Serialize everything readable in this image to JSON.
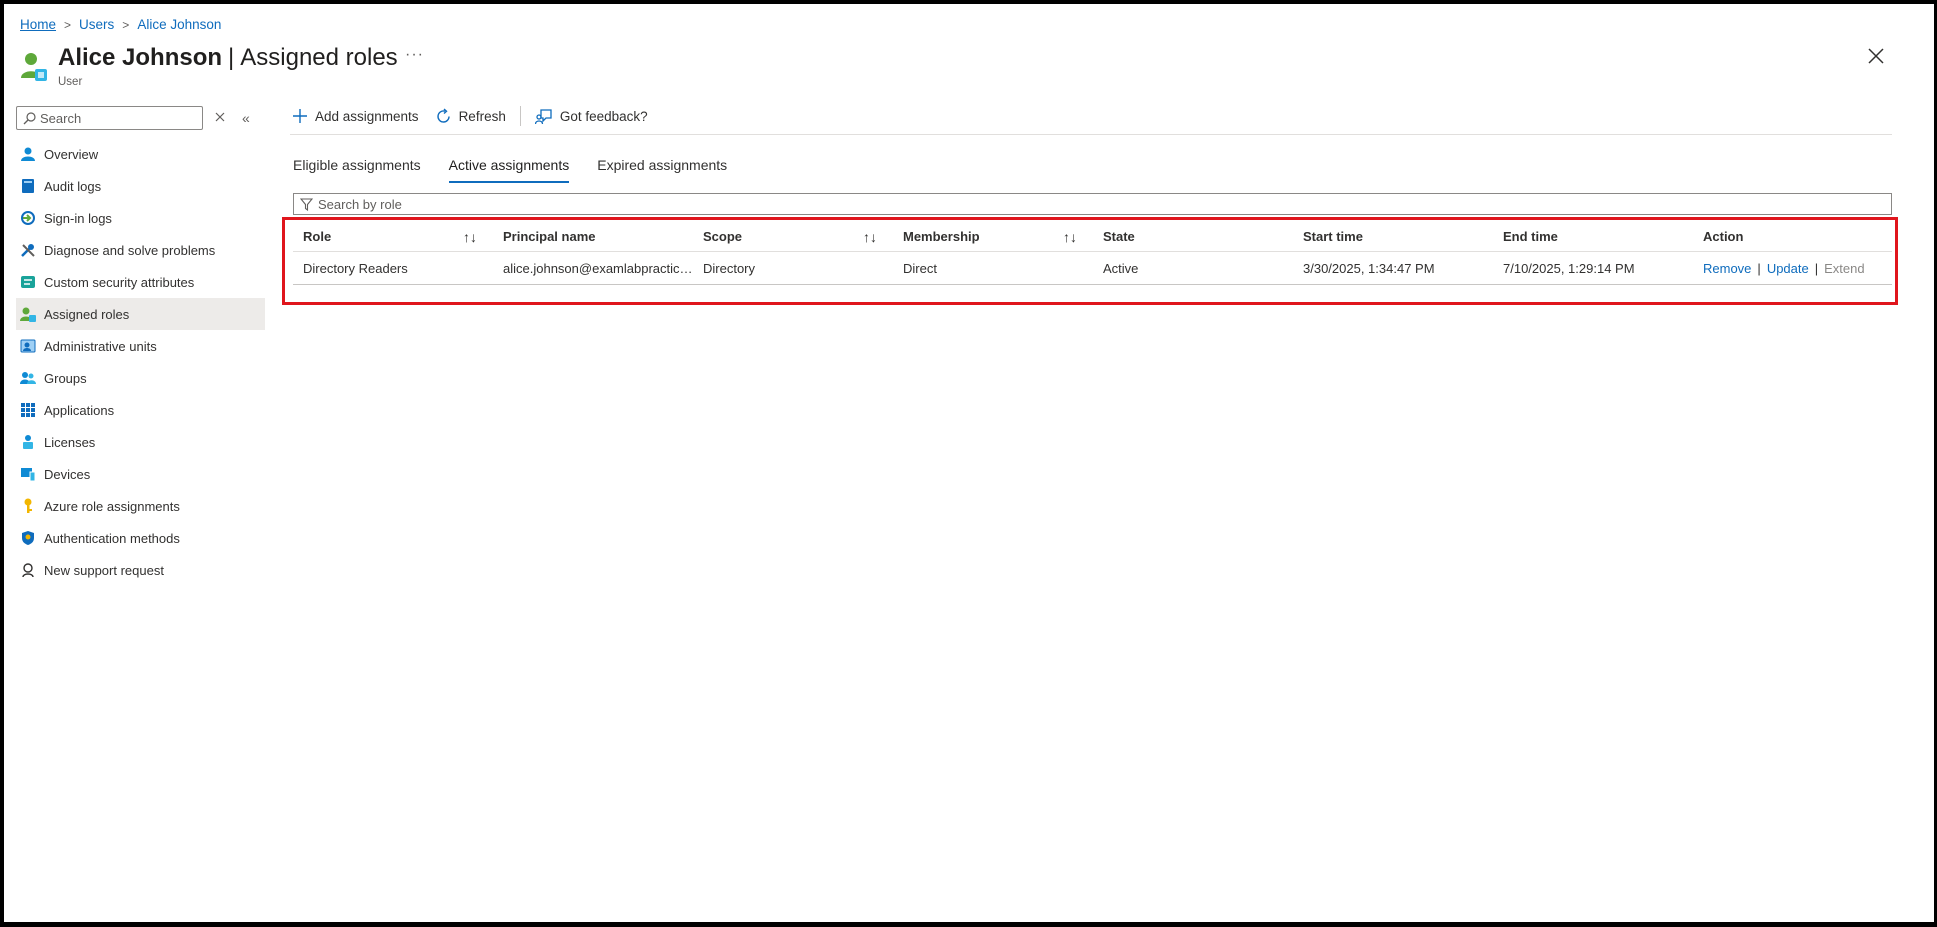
{
  "breadcrumb": {
    "home": "Home",
    "users": "Users",
    "current": "Alice Johnson"
  },
  "header": {
    "name": "Alice Johnson",
    "separator": "|",
    "section": "Assigned roles",
    "subtitle": "User",
    "more": "···"
  },
  "sidebar": {
    "search_placeholder": "Search",
    "items": [
      {
        "label": "Overview",
        "icon": "user-icon"
      },
      {
        "label": "Audit logs",
        "icon": "book-icon"
      },
      {
        "label": "Sign-in logs",
        "icon": "sign-in-icon"
      },
      {
        "label": "Diagnose and solve problems",
        "icon": "wrench-icon"
      },
      {
        "label": "Custom security attributes",
        "icon": "attributes-icon"
      },
      {
        "label": "Assigned roles",
        "icon": "assigned-roles-icon",
        "active": true
      },
      {
        "label": "Administrative units",
        "icon": "admin-units-icon"
      },
      {
        "label": "Groups",
        "icon": "groups-icon"
      },
      {
        "label": "Applications",
        "icon": "apps-grid-icon"
      },
      {
        "label": "Licenses",
        "icon": "licenses-icon"
      },
      {
        "label": "Devices",
        "icon": "devices-icon"
      },
      {
        "label": "Azure role assignments",
        "icon": "key-icon"
      },
      {
        "label": "Authentication methods",
        "icon": "shield-icon"
      },
      {
        "label": "New support request",
        "icon": "support-icon"
      }
    ]
  },
  "toolbar": {
    "add": "Add assignments",
    "refresh": "Refresh",
    "feedback": "Got feedback?"
  },
  "tabs": [
    "Eligible assignments",
    "Active assignments",
    "Expired assignments"
  ],
  "filter": {
    "placeholder": "Search by role"
  },
  "table": {
    "columns": [
      "Role",
      "Principal name",
      "Scope",
      "Membership",
      "State",
      "Start time",
      "End time",
      "Action"
    ],
    "rows": [
      {
        "role": "Directory Readers",
        "principal": "alice.johnson@examlabpractice...",
        "scope": "Directory",
        "membership": "Direct",
        "state": "Active",
        "start": "3/30/2025, 1:34:47 PM",
        "end": "7/10/2025, 1:29:14 PM",
        "actions": {
          "remove": "Remove",
          "update": "Update",
          "extend": "Extend",
          "sep": "|"
        }
      }
    ]
  },
  "colors": {
    "accent": "#0f6cbd",
    "highlight": "#e0161d"
  }
}
